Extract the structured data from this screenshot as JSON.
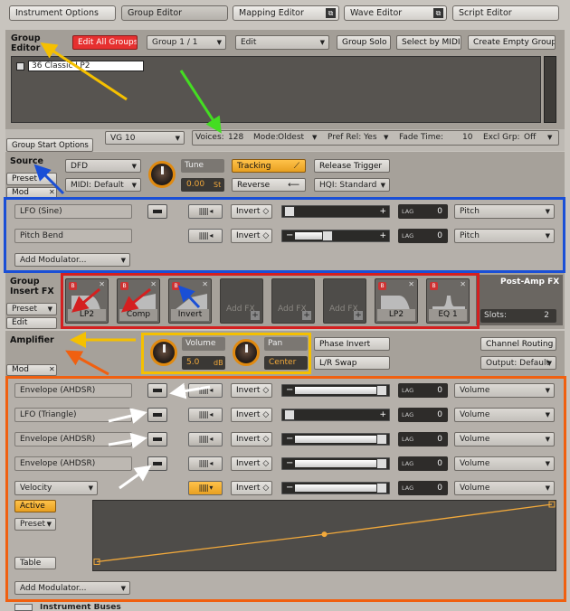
{
  "top_tabs": [
    {
      "label": "Instrument Options"
    },
    {
      "label": "Group Editor"
    },
    {
      "label": "Mapping Editor"
    },
    {
      "label": "Wave Editor"
    },
    {
      "label": "Script Editor"
    }
  ],
  "group_editor": {
    "title_line1": "Group",
    "title_line2": "Editor",
    "edit_all_groups": "Edit All Groups",
    "group_selector": "Group 1 / 1",
    "edit_menu": "Edit",
    "group_solo": "Group Solo",
    "select_by_midi": "Select by MIDI",
    "create_empty_group": "Create Empty Group",
    "group_name": "36 Classic LP2"
  },
  "group_start": {
    "tab": "Group Start Options",
    "vg": "VG 10",
    "voices_label": "Voices:",
    "voices_value": "128",
    "mode_label": "Mode:",
    "mode_value": "Oldest",
    "pref_rel_label": "Pref Rel:",
    "pref_rel_value": "Yes",
    "fade_time_label": "Fade Time:",
    "fade_time_value": "10",
    "excl_grp_label": "Excl Grp:",
    "excl_grp_value": "Off"
  },
  "source": {
    "title": "Source",
    "preset": "Preset",
    "mod": "Mod",
    "mode": "DFD",
    "midi": "MIDI: Default",
    "tune_label": "Tune",
    "tune_value": "0.00",
    "tune_unit": "St",
    "tracking": "Tracking",
    "reverse": "Reverse",
    "release_trigger": "Release Trigger",
    "hqi": "HQI: Standard",
    "mod_rows": [
      {
        "source": "LFO (Sine)",
        "invert": "Invert",
        "lag_label": "LAG",
        "lag": "0",
        "target": "Pitch"
      },
      {
        "source": "Pitch Bend",
        "invert": "Invert",
        "lag_label": "LAG",
        "lag": "0",
        "target": "Pitch"
      }
    ],
    "add_modulator": "Add Modulator..."
  },
  "group_fx": {
    "title_line1": "Group",
    "title_line2": "Insert FX",
    "preset": "Preset",
    "edit": "Edit",
    "slots": [
      {
        "label": "LP2",
        "type": "filled"
      },
      {
        "label": "Comp",
        "type": "filled"
      },
      {
        "label": "Invert",
        "type": "filled"
      },
      {
        "label": "Add FX",
        "type": "empty"
      },
      {
        "label": "Add FX",
        "type": "empty"
      },
      {
        "label": "Add FX",
        "type": "empty"
      }
    ],
    "post_amp_title": "Post-Amp FX",
    "post_slots": [
      {
        "label": "LP2"
      },
      {
        "label": "EQ 1"
      }
    ],
    "slots_label": "Slots:",
    "slots_value": "2"
  },
  "amplifier": {
    "title": "Amplifier",
    "mod": "Mod",
    "volume_label": "Volume",
    "volume_value": "5.0",
    "volume_unit": "dB",
    "pan_label": "Pan",
    "pan_value": "Center",
    "phase_invert": "Phase Invert",
    "lr_swap": "L/R Swap",
    "channel_routing": "Channel Routing",
    "output": "Output: Default",
    "mod_rows": [
      {
        "source": "Envelope (AHDSR)",
        "invert": "Invert",
        "lag_label": "LAG",
        "lag": "0",
        "target": "Volume"
      },
      {
        "source": "LFO (Triangle)",
        "invert": "Invert",
        "lag_label": "LAG",
        "lag": "0",
        "target": "Volume"
      },
      {
        "source": "Envelope (AHDSR)",
        "invert": "Invert",
        "lag_label": "LAG",
        "lag": "0",
        "target": "Volume"
      },
      {
        "source": "Envelope (AHDSR)",
        "invert": "Invert",
        "lag_label": "LAG",
        "lag": "0",
        "target": "Volume"
      },
      {
        "source": "Velocity",
        "invert": "Invert",
        "lag_label": "LAG",
        "lag": "0",
        "target": "Volume"
      }
    ],
    "active": "Active",
    "preset": "Preset",
    "table": "Table",
    "add_modulator": "Add Modulator...",
    "velocity_curve": [
      [
        0,
        0.08
      ],
      [
        0.5,
        0.52
      ],
      [
        1,
        1
      ]
    ]
  },
  "footer": {
    "instrument_buses": "Instrument Buses"
  },
  "colors": {
    "accent_orange": "#f2a93b",
    "highlight_blue": "#1a4fd6",
    "highlight_red": "#d42020",
    "highlight_yellow": "#f5c000",
    "highlight_orange": "#f06010",
    "arrow_green": "#44dd22"
  }
}
